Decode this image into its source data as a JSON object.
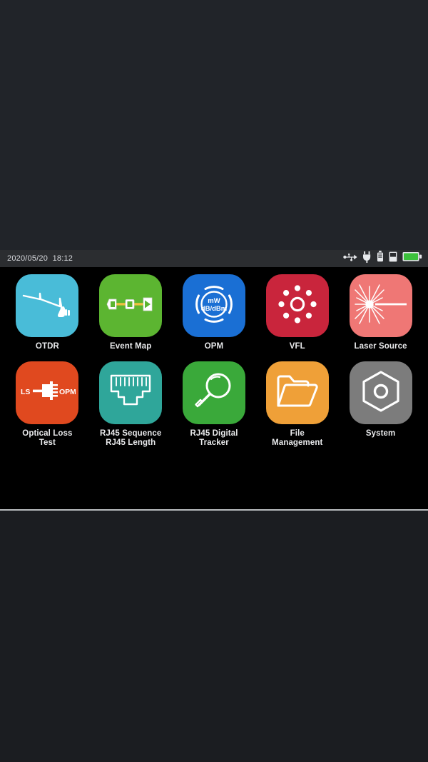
{
  "device": {
    "screen_bg": "#000000",
    "frame_bg": "#212429",
    "divider_color": "#b9bcbf"
  },
  "statusbar": {
    "background": "#2b2d30",
    "datetime": "2020/05/20  18:12",
    "date": "2020/05/20",
    "time": "18:12",
    "icons": [
      {
        "name": "usb-icon",
        "label": "USB",
        "color": "#e7e9ec"
      },
      {
        "name": "power-plug-icon",
        "label": "Power plug",
        "color": "#e7e9ec"
      },
      {
        "name": "charger-icon",
        "label": "Charger",
        "color": "#e7e9ec"
      },
      {
        "name": "battery-empty-icon",
        "label": "Battery",
        "color": "#e7e9ec"
      },
      {
        "name": "battery-charged-icon",
        "label": "Battery charged",
        "color": "#3cc13c"
      }
    ]
  },
  "home": {
    "rows": [
      {
        "apps": [
          {
            "id": "otdr",
            "label": "OTDR",
            "color": "#49bcd8",
            "icon": "otdr-trace-icon"
          },
          {
            "id": "event-map",
            "label": "Event Map",
            "color": "#5cb531",
            "icon": "fiber-link-icon"
          },
          {
            "id": "opm",
            "label": "OPM",
            "color": "#1a6fd4",
            "icon": "power-meter-gauge-icon",
            "gauge_top": "mW",
            "gauge_bottom": "dB/dBm"
          },
          {
            "id": "vfl",
            "label": "VFL",
            "color": "#c9253c",
            "icon": "brightness-sun-icon"
          },
          {
            "id": "laser-source",
            "label": "Laser Source",
            "color": "#ef7775",
            "icon": "laser-burst-icon"
          }
        ]
      },
      {
        "apps": [
          {
            "id": "optical-loss-test",
            "label": "Optical Loss\nTest",
            "color": "#e0491f",
            "icon": "loss-test-connector-icon",
            "badge_left": "LS",
            "badge_right": "OPM"
          },
          {
            "id": "rj45-sequence",
            "label": "RJ45 Sequence\nRJ45 Length",
            "color": "#2fa69a",
            "icon": "rj45-jack-icon"
          },
          {
            "id": "rj45-digital-tracker",
            "label": "RJ45 Digital\nTracker",
            "color": "#3aa93a",
            "icon": "magnifier-icon"
          },
          {
            "id": "file-management",
            "label": "File\nManagement",
            "color": "#efa038",
            "icon": "folder-open-icon"
          },
          {
            "id": "system",
            "label": "System",
            "color": "#7c7c7c",
            "icon": "hexagon-settings-icon"
          }
        ]
      }
    ]
  }
}
